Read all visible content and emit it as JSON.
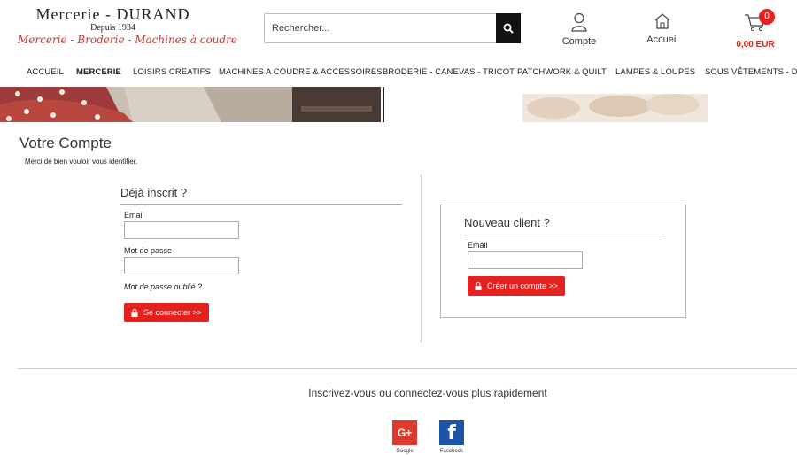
{
  "brand": {
    "name": "Mercerie - DURAND",
    "since": "Depuis 1934",
    "tagline": "Mercerie - Broderie - Machines à coudre"
  },
  "search": {
    "placeholder": "Rechercher..."
  },
  "header_icons": {
    "account_label": "Compte",
    "home_label": "Accueil",
    "cart_count": "0",
    "cart_total": "0,00 EUR"
  },
  "nav": {
    "items": [
      "ACCUEIL",
      "MERCERIE",
      "LOISIRS CREATIFS",
      "MACHINES A COUDRE & ACCESSOIRES",
      "BRODERIE - CANEVAS - TRICOT",
      "PATCHWORK & QUILT",
      "LAMPES & LOUPES",
      "SOUS VÊTEMENTS - DIVI"
    ],
    "active": "MERCERIE"
  },
  "page": {
    "title": "Votre Compte",
    "subtitle": "Merci de bien vouloir vous identifier."
  },
  "login": {
    "heading": "Déjà inscrit ?",
    "email_label": "Email",
    "password_label": "Mot de passe",
    "forgot": "Mot de passe oublié ?",
    "submit": "Se connecter >>"
  },
  "register": {
    "heading": "Nouveau client ?",
    "email_label": "Email",
    "submit": "Créer un compte >>"
  },
  "social": {
    "title": "Inscrivez-vous ou connectez-vous plus rapidement",
    "google_label": "Google",
    "google_glyph": "G+",
    "facebook_label": "Facebook",
    "facebook_glyph": "f"
  },
  "colors": {
    "accent_red": "#e3211e",
    "google": "#dd3b2b",
    "facebook": "#1b54a6"
  }
}
